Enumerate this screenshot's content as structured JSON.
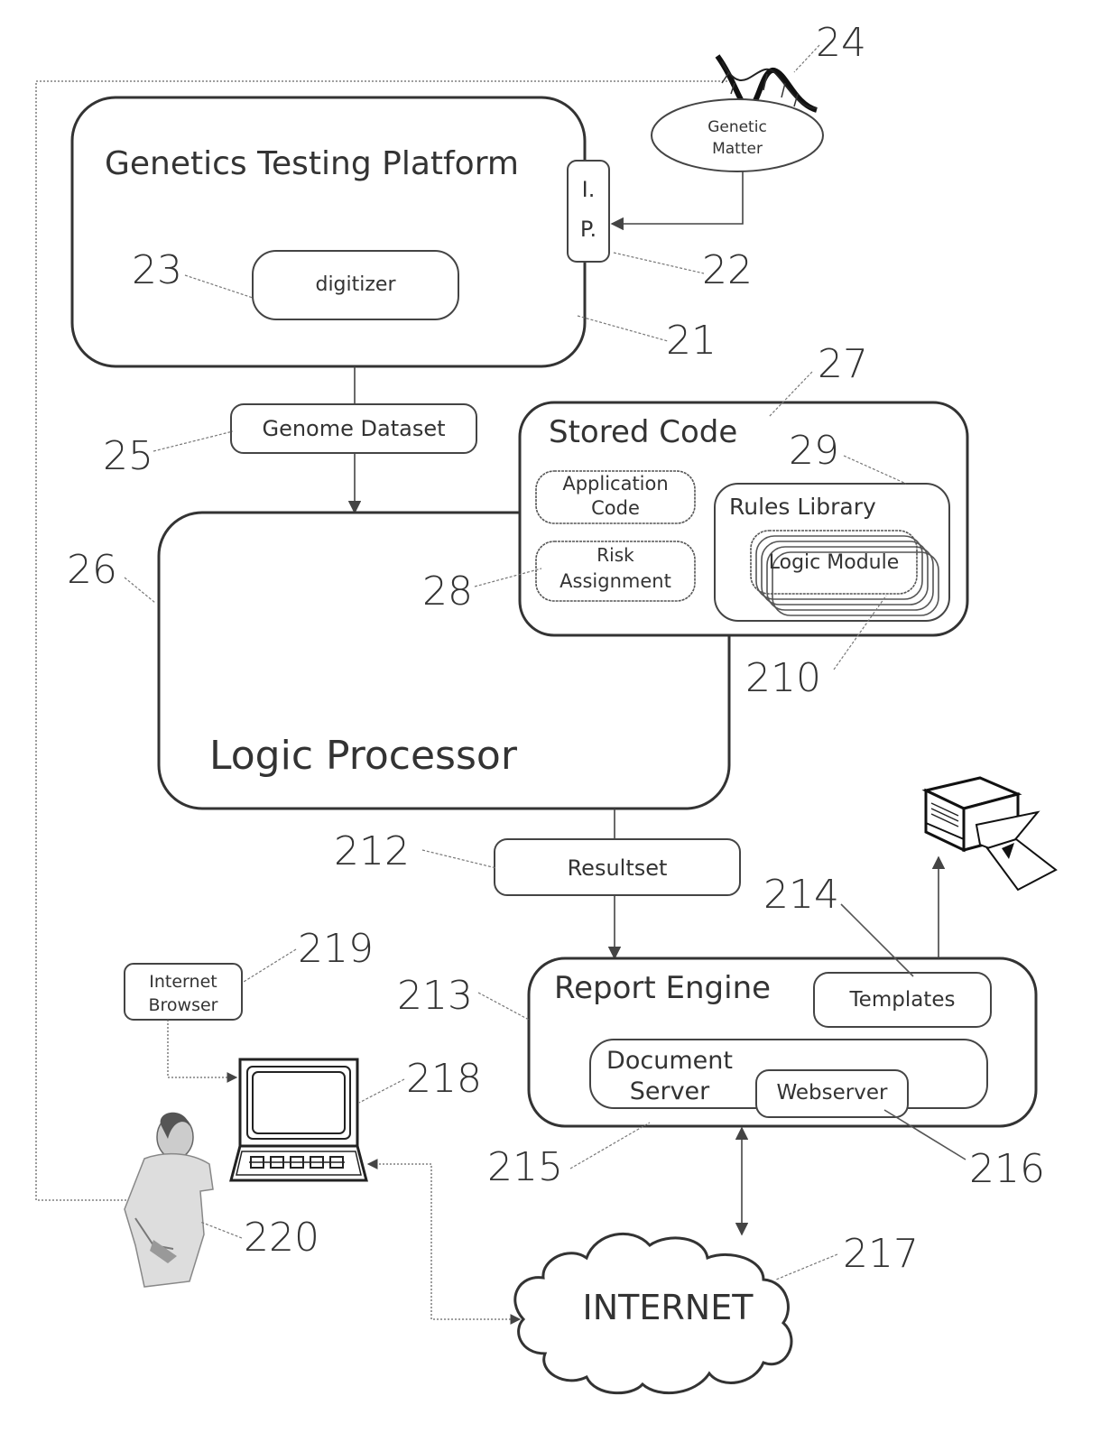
{
  "diagram": {
    "blocks": {
      "genetics_platform": {
        "label": "Genetics Testing Platform",
        "ref": "21"
      },
      "interface_port": {
        "label_line1": "I.",
        "label_line2": "P.",
        "ref": "22"
      },
      "digitizer": {
        "label": "digitizer",
        "ref": "23"
      },
      "genetic_matter": {
        "label_line1": "Genetic",
        "label_line2": "Matter",
        "ref": "24"
      },
      "genome_dataset": {
        "label": "Genome Dataset",
        "ref": "25"
      },
      "logic_processor": {
        "label": "Logic Processor",
        "ref": "26"
      },
      "stored_code": {
        "label": "Stored Code",
        "ref": "27"
      },
      "application_code": {
        "label_line1": "Application",
        "label_line2": "Code"
      },
      "risk_assignment": {
        "label_line1": "Risk",
        "label_line2": "Assignment",
        "ref": "28"
      },
      "rules_library": {
        "label": "Rules Library",
        "ref": "29"
      },
      "logic_module": {
        "label": "Logic Module",
        "ref": "210"
      },
      "resultset": {
        "label": "Resultset",
        "ref": "212"
      },
      "report_engine": {
        "label": "Report Engine",
        "ref": "213"
      },
      "templates": {
        "label": "Templates",
        "ref": "214"
      },
      "document_server": {
        "label_line1": "Document",
        "label_line2": "Server",
        "ref": "215"
      },
      "webserver": {
        "label": "Webserver",
        "ref": "216"
      },
      "internet": {
        "label": "INTERNET",
        "ref": "217"
      },
      "computer": {
        "ref": "218"
      },
      "internet_browser": {
        "label_line1": "Internet",
        "label_line2": "Browser",
        "ref": "219"
      },
      "user": {
        "ref": "220"
      }
    },
    "icons": [
      "dna-helix-icon",
      "printer-icon",
      "computer-terminal-icon",
      "person-figure-icon",
      "cloud-icon"
    ]
  }
}
